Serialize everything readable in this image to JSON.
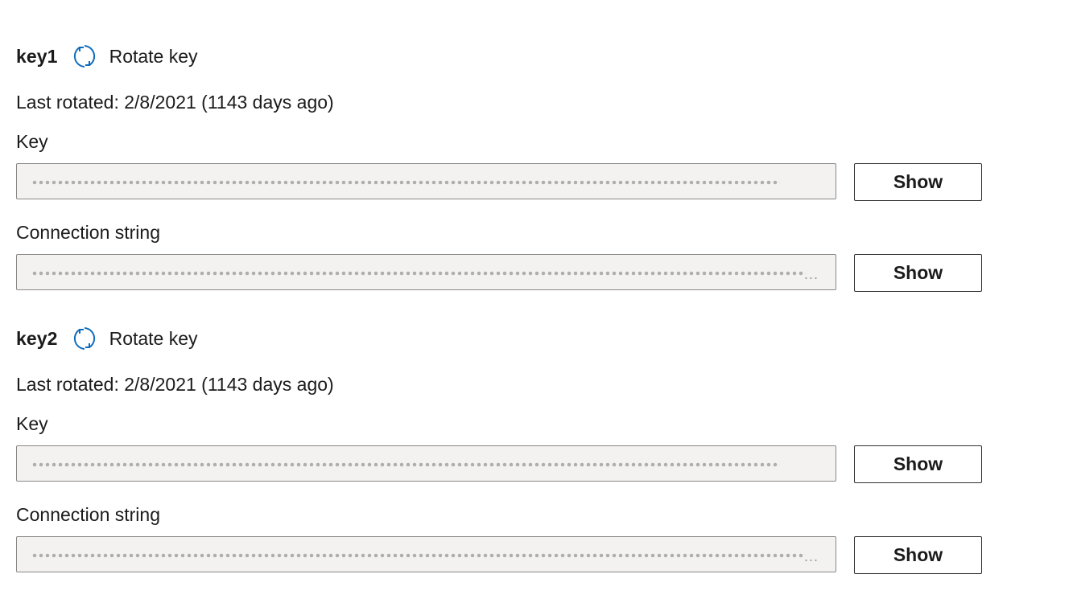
{
  "keys": [
    {
      "name": "key1",
      "rotate_label": "Rotate key",
      "last_rotated": "Last rotated: 2/8/2021 (1143 days ago)",
      "key_label": "Key",
      "connection_label": "Connection string",
      "show_key_label": "Show",
      "show_connection_label": "Show",
      "connection_ellipsis": "..."
    },
    {
      "name": "key2",
      "rotate_label": "Rotate key",
      "last_rotated": "Last rotated: 2/8/2021 (1143 days ago)",
      "key_label": "Key",
      "connection_label": "Connection string",
      "show_key_label": "Show",
      "show_connection_label": "Show",
      "connection_ellipsis": "..."
    }
  ],
  "icons": {
    "rotate": "rotate-icon"
  },
  "colors": {
    "accent": "#0f6cbd",
    "field_bg": "#f3f2f1",
    "field_border": "#8a8886",
    "masked_dot": "#b0aeac"
  }
}
